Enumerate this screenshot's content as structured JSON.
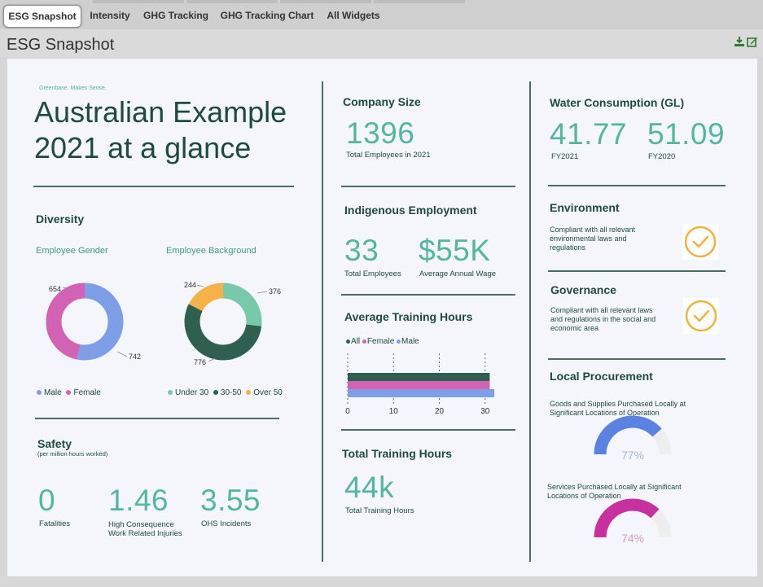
{
  "tabs": [
    {
      "label": "ESG Snapshot",
      "active": true
    },
    {
      "label": "Intensity"
    },
    {
      "label": "GHG Tracking"
    },
    {
      "label": "GHG Tracking Chart"
    },
    {
      "label": "All Widgets"
    }
  ],
  "header": {
    "title": "ESG Snapshot",
    "icons": [
      "download-icon",
      "edit-icon"
    ]
  },
  "report": {
    "tagline": "Greenbase. Makes Sense.",
    "title_line1": "Australian Example",
    "title_line2": "2021 at a glance"
  },
  "diversity": {
    "heading": "Diversity",
    "gender": {
      "title": "Employee Gender",
      "label_female": "654",
      "label_male": "742",
      "legend": [
        "Male",
        "Female"
      ],
      "colors": {
        "male": "#7f9ee8",
        "female": "#d262b4"
      }
    },
    "background": {
      "title": "Employee Background",
      "label_under30": "376",
      "label_30_50": "776",
      "label_over50": "244",
      "legend": [
        "Under 30",
        "30-50",
        "Over 50"
      ],
      "colors": {
        "under30": "#78c9a9",
        "30_50": "#2f5f4f",
        "over50": "#f5b247"
      }
    }
  },
  "chart_data": [
    {
      "type": "pie",
      "title": "Employee Gender",
      "categories": [
        "Male",
        "Female"
      ],
      "values": [
        742,
        654
      ]
    },
    {
      "type": "pie",
      "title": "Employee Background",
      "categories": [
        "Under 30",
        "30-50",
        "Over 50"
      ],
      "values": [
        376,
        776,
        244
      ]
    },
    {
      "type": "bar",
      "title": "Average Training Hours",
      "orientation": "horizontal",
      "categories": [
        "All",
        "Female",
        "Male"
      ],
      "values": [
        31,
        31,
        32
      ],
      "xlim": [
        0,
        32
      ],
      "x_ticks": [
        0,
        10,
        20,
        30
      ],
      "colors": [
        "#2f5f4f",
        "#d262b4",
        "#7f9ee8"
      ]
    },
    {
      "type": "pie",
      "title": "Goods and Supplies Purchased Locally at Significant Locations of Operation",
      "categories": [
        "Local",
        "Other"
      ],
      "values": [
        77,
        23
      ]
    },
    {
      "type": "pie",
      "title": "Services Purchased Locally at Significant Locations of Operation",
      "categories": [
        "Local",
        "Other"
      ],
      "values": [
        74,
        26
      ]
    }
  ],
  "safety": {
    "heading": "Safety",
    "subheading": "(per million hours worked)",
    "fatalities_value": "0",
    "fatalities_label": "Fatalities",
    "injuries_value": "1.46",
    "injuries_label_line1": "High Consequence",
    "injuries_label_line2": "Work Related Injuries",
    "ohs_value": "3.55",
    "ohs_label": "OHS Incidents"
  },
  "company_size": {
    "heading": "Company Size",
    "value": "1396",
    "label": "Total Employees in 2021"
  },
  "indigenous": {
    "heading": "Indigenous Employment",
    "employees_value": "33",
    "employees_label": "Total Employees",
    "wage_value": "$55K",
    "wage_label": "Average Annual Wage"
  },
  "training_avg": {
    "heading": "Average Training Hours",
    "legend": [
      "All",
      "Female",
      "Male"
    ],
    "ticks": [
      "0",
      "10",
      "20",
      "30"
    ]
  },
  "training_total": {
    "heading": "Total Training Hours",
    "value": "44k",
    "label": "Total Training Hours"
  },
  "water": {
    "heading": "Water Consumption (GL)",
    "fy21_value": "41.77",
    "fy21_label": "FY2021",
    "fy20_value": "51.09",
    "fy20_label": "FY2020"
  },
  "environment": {
    "heading": "Environment",
    "line1": "Compliant with all relevant",
    "line2": "environmental laws and",
    "line3": "regulations"
  },
  "governance": {
    "heading": "Governance",
    "line1": "Compliant with all relevant laws",
    "line2": "and regulations in the social and",
    "line3": "economic area"
  },
  "procurement": {
    "heading": "Local Procurement",
    "goods_line1": "Goods and Supplies Purchased Locally at",
    "goods_line2": "Significant Locations of Operation",
    "goods_pct": "77%",
    "services_line1": "Services Purchased Locally at Significant",
    "services_line2": "Locations of Operation",
    "services_pct": "74%",
    "colors": {
      "goods": "#5b82e0",
      "services": "#c8309f",
      "track": "#eeeeee"
    }
  },
  "check_color": "#f0b23c"
}
